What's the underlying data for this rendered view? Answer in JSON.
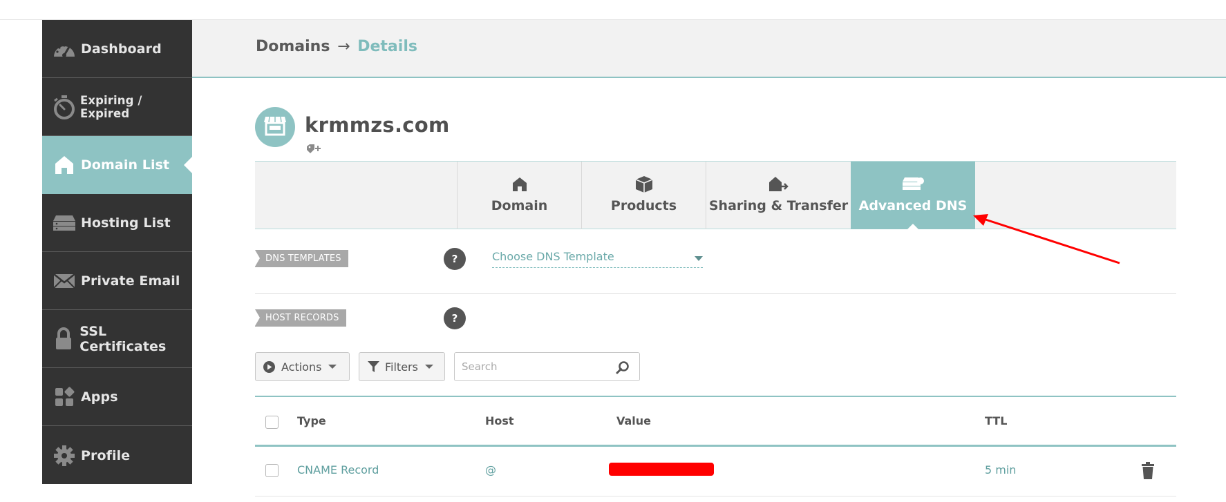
{
  "sidebar": {
    "items": [
      {
        "label": "Dashboard",
        "icon": "speedometer-icon"
      },
      {
        "label": "Expiring / Expired",
        "icon": "stopwatch-icon"
      },
      {
        "label": "Domain List",
        "icon": "home-icon"
      },
      {
        "label": "Hosting List",
        "icon": "server-icon"
      },
      {
        "label": "Private Email",
        "icon": "envelope-icon"
      },
      {
        "label": "SSL Certificates",
        "icon": "lock-icon"
      },
      {
        "label": "Apps",
        "icon": "apps-icon"
      },
      {
        "label": "Profile",
        "icon": "gear-icon"
      }
    ],
    "active_index": 2
  },
  "breadcrumb": {
    "parent": "Domains",
    "separator": "→",
    "current": "Details"
  },
  "domain": {
    "name": "krmmzs.com",
    "avatar_icon": "storefront-icon",
    "tag_icon": "tag-add-icon"
  },
  "tabs": [
    {
      "label": "Domain",
      "icon": "home-icon"
    },
    {
      "label": "Products",
      "icon": "box-icon"
    },
    {
      "label": "Sharing & Transfer",
      "icon": "home-share-icon"
    },
    {
      "label": "Advanced DNS",
      "icon": "server-icon"
    }
  ],
  "active_tab": "Advanced DNS",
  "dns_templates": {
    "label": "DNS TEMPLATES",
    "help": "?",
    "select_value": "Choose DNS Template"
  },
  "host_records": {
    "label": "HOST RECORDS",
    "help": "?"
  },
  "toolbar": {
    "actions_label": "Actions",
    "filters_label": "Filters",
    "search_placeholder": "Search"
  },
  "table": {
    "columns": [
      "Type",
      "Host",
      "Value",
      "TTL"
    ],
    "rows": [
      {
        "type": "CNAME Record",
        "host": "@",
        "value": "",
        "ttl": "5 min"
      }
    ]
  },
  "colors": {
    "accent": "#8ec3c3",
    "sidebar_bg": "#333333",
    "annotation_arrow": "#ff0000",
    "redaction": "#ff0000"
  }
}
